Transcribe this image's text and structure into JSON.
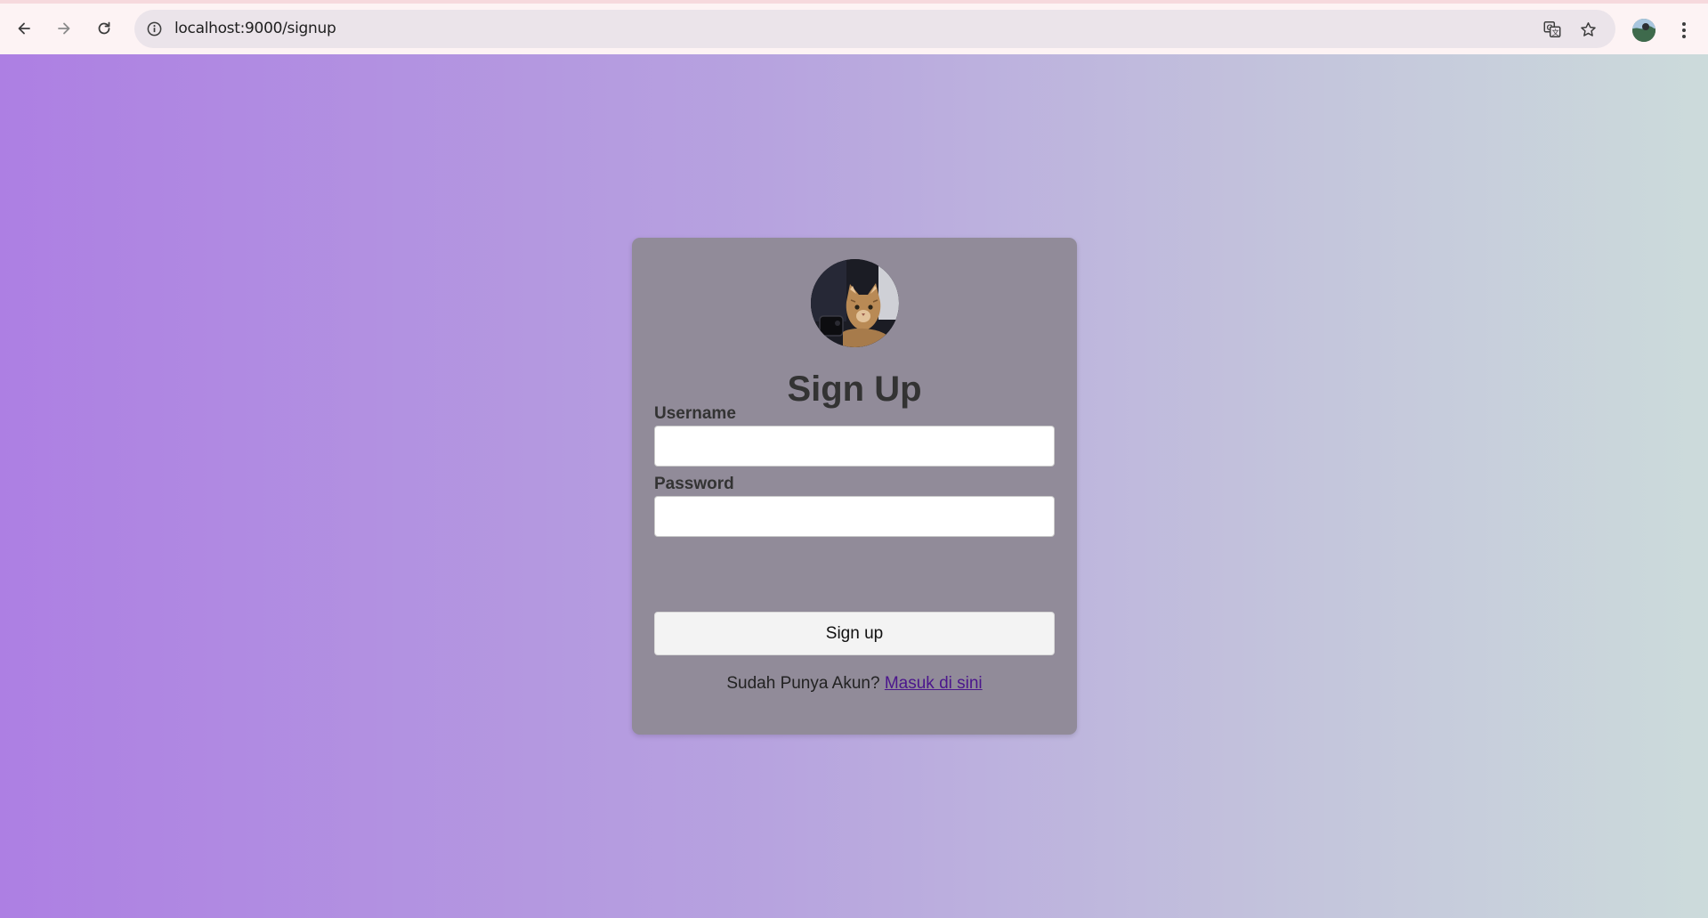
{
  "browser": {
    "url": "localhost:9000/signup",
    "back_icon": "arrow-left-icon",
    "forward_icon": "arrow-right-icon",
    "reload_icon": "reload-icon",
    "site_info_icon": "info-icon",
    "translate_icon": "translate-icon",
    "bookmark_icon": "star-icon",
    "menu_icon": "kebab-menu-icon"
  },
  "page": {
    "background_colors": [
      "#ad7fe3",
      "#ccdbdb"
    ]
  },
  "card": {
    "avatar_alt": "cat-photo",
    "title": "Sign Up",
    "username_label": "Username",
    "username_value": "",
    "password_label": "Password",
    "password_value": "",
    "submit_label": "Sign up",
    "footer_prompt": "Sudah Punya Akun? ",
    "footer_link": "Masuk di sini",
    "background_color": "#918b99",
    "link_color": "#4b168c"
  }
}
